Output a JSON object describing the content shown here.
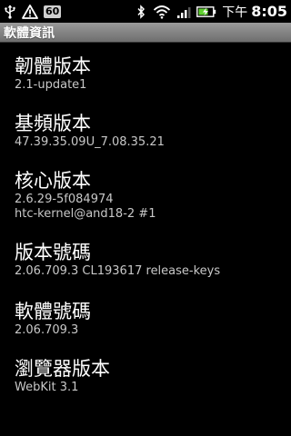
{
  "status_bar": {
    "battery_badge": "60",
    "clock_prefix": "下午",
    "clock_time": "8:05",
    "icons": [
      "usb-icon",
      "warning-icon",
      "battery-level-badge",
      "bluetooth-icon",
      "wifi-icon",
      "signal-icon",
      "battery-charging-icon"
    ]
  },
  "header": {
    "title": "軟體資訊"
  },
  "items": [
    {
      "label": "韌體版本",
      "value": "2.1-update1"
    },
    {
      "label": "基頻版本",
      "value": " 47.39.35.09U_7.08.35.21"
    },
    {
      "label": "核心版本",
      "value": "2.6.29-5f084974",
      "value2": "htc-kernel@and18-2 #1"
    },
    {
      "label": "版本號碼",
      "value": "2.06.709.3 CL193617 release-keys"
    },
    {
      "label": "軟體號碼",
      "value": "2.06.709.3"
    },
    {
      "label": "瀏覽器版本",
      "value": "WebKit 3.1"
    }
  ]
}
